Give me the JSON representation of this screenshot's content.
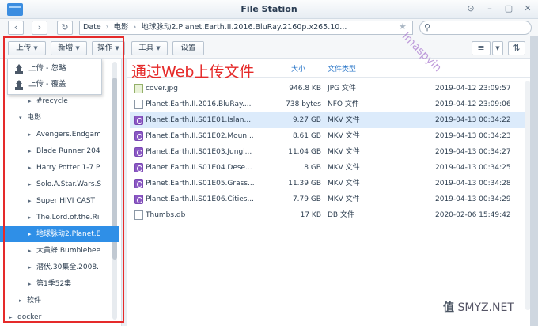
{
  "window": {
    "title": "File Station"
  },
  "nav": {
    "path": [
      "Date",
      "电影",
      "地球脉动2.Planet.Earth.II.2016.BluRay.2160p.x265.10..."
    ]
  },
  "toolbar": {
    "upload": "上传",
    "create": "新增",
    "action": "操作",
    "tools": "工具",
    "settings": "设置"
  },
  "upload_menu": [
    "上传 - 忽略",
    "上传 - 覆盖"
  ],
  "annotation": "通过Web上传文件",
  "watermark": "Imaspyin",
  "tree": {
    "items": [
      {
        "label": "#recycle",
        "depth": 2,
        "arrow": "▸"
      },
      {
        "label": "电影",
        "depth": 1,
        "arrow": "▾"
      },
      {
        "label": "Avengers.Endgam",
        "depth": 2,
        "arrow": "▸"
      },
      {
        "label": "Blade Runner 204",
        "depth": 2,
        "arrow": "▸"
      },
      {
        "label": "Harry Potter 1-7 P",
        "depth": 2,
        "arrow": "▸"
      },
      {
        "label": "Solo.A.Star.Wars.S",
        "depth": 2,
        "arrow": "▸"
      },
      {
        "label": "Super HIVI CAST",
        "depth": 2,
        "arrow": "▸"
      },
      {
        "label": "The.Lord.of.the.Ri",
        "depth": 2,
        "arrow": "▸"
      },
      {
        "label": "地球脉动2.Planet.E",
        "depth": 2,
        "arrow": "▸",
        "selected": true
      },
      {
        "label": "大黄蜂.Bumblebee",
        "depth": 2,
        "arrow": "▸"
      },
      {
        "label": "潜伏.30集全.2008.",
        "depth": 2,
        "arrow": "▸"
      },
      {
        "label": "第1季52集",
        "depth": 2,
        "arrow": "▸"
      },
      {
        "label": "软件",
        "depth": 1,
        "arrow": "▸"
      },
      {
        "label": "docker",
        "depth": 0,
        "arrow": "▸"
      }
    ]
  },
  "list": {
    "columns": {
      "size": "大小",
      "type": "文件类型"
    },
    "rows": [
      {
        "name": "cover.jpg",
        "size": "946.8 KB",
        "type": "JPG 文件",
        "date": "2019-04-12 23:09:57",
        "icon": "jpg"
      },
      {
        "name": "Planet.Earth.II.2016.BluRay....",
        "size": "738 bytes",
        "type": "NFO 文件",
        "date": "2019-04-12 23:09:06",
        "icon": "doc"
      },
      {
        "name": "Planet.Earth.II.S01E01.Islan...",
        "size": "9.27 GB",
        "type": "MKV 文件",
        "date": "2019-04-13 00:34:22",
        "icon": "mkv",
        "selected": true
      },
      {
        "name": "Planet.Earth.II.S01E02.Moun...",
        "size": "8.61 GB",
        "type": "MKV 文件",
        "date": "2019-04-13 00:34:23",
        "icon": "mkv"
      },
      {
        "name": "Planet.Earth.II.S01E03.Jungl...",
        "size": "11.04 GB",
        "type": "MKV 文件",
        "date": "2019-04-13 00:34:27",
        "icon": "mkv"
      },
      {
        "name": "Planet.Earth.II.S01E04.Dese...",
        "size": "8 GB",
        "type": "MKV 文件",
        "date": "2019-04-13 00:34:25",
        "icon": "mkv"
      },
      {
        "name": "Planet.Earth.II.S01E05.Grass...",
        "size": "11.39 GB",
        "type": "MKV 文件",
        "date": "2019-04-13 00:34:28",
        "icon": "mkv"
      },
      {
        "name": "Planet.Earth.II.S01E06.Cities...",
        "size": "7.79 GB",
        "type": "MKV 文件",
        "date": "2019-04-13 00:34:29",
        "icon": "mkv"
      },
      {
        "name": "Thumbs.db",
        "size": "17 KB",
        "type": "DB 文件",
        "date": "2020-02-06 15:49:42",
        "icon": "doc"
      }
    ]
  },
  "logo": {
    "mark": "值",
    "text": "SMYZ.NET"
  },
  "colors": {
    "accent": "#2f8fe7",
    "annotation": "#e52a2a",
    "mkv": "#8b58c4"
  }
}
